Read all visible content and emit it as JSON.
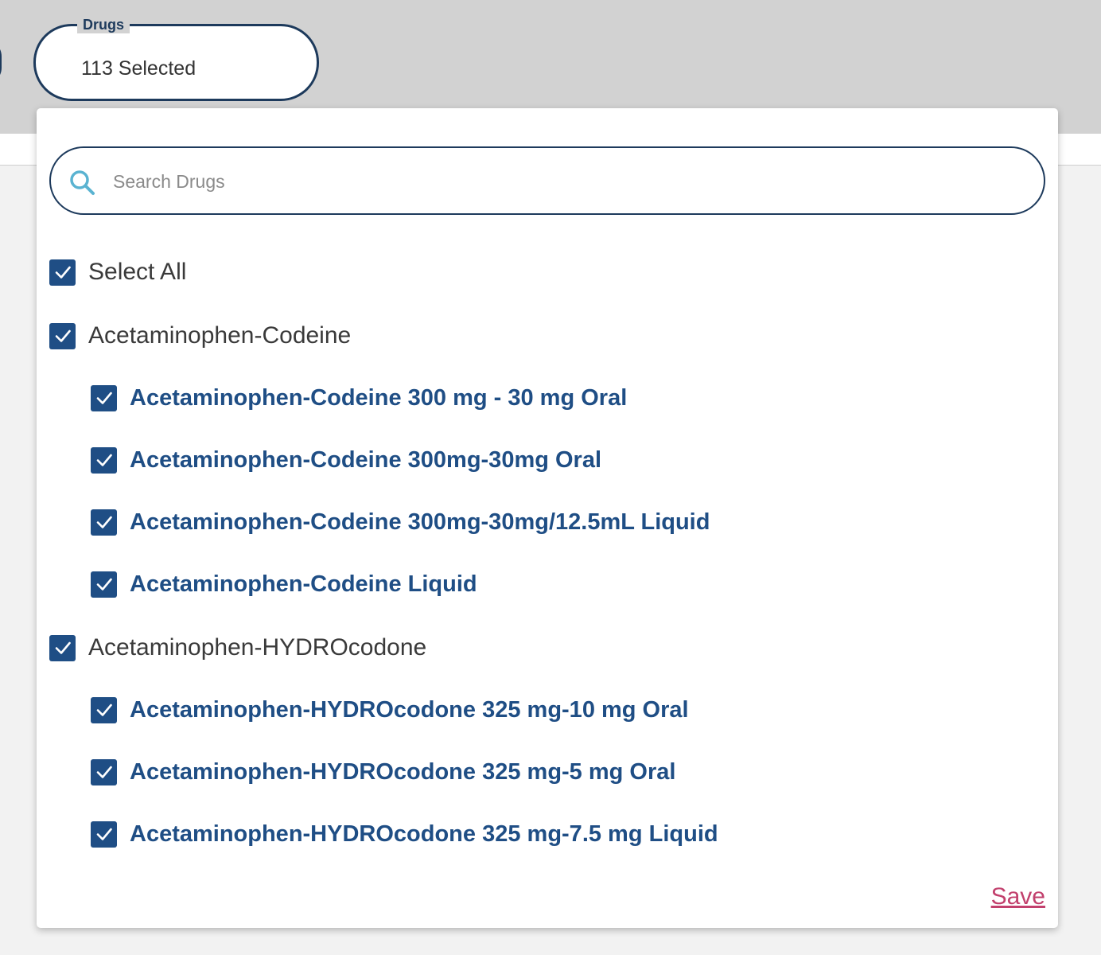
{
  "filter": {
    "label": "Drugs",
    "value": "113 Selected"
  },
  "search": {
    "placeholder": "Search Drugs",
    "value": ""
  },
  "select_all": {
    "label": "Select All",
    "checked": true
  },
  "groups": [
    {
      "label": "Acetaminophen-Codeine",
      "checked": true,
      "items": [
        {
          "label": "Acetaminophen-Codeine 300 mg - 30 mg Oral",
          "checked": true
        },
        {
          "label": "Acetaminophen-Codeine 300mg-30mg Oral",
          "checked": true
        },
        {
          "label": "Acetaminophen-Codeine 300mg-30mg/12.5mL Liquid",
          "checked": true
        },
        {
          "label": "Acetaminophen-Codeine Liquid",
          "checked": true
        }
      ]
    },
    {
      "label": "Acetaminophen-HYDROcodone",
      "checked": true,
      "items": [
        {
          "label": "Acetaminophen-HYDROcodone 325 mg-10 mg Oral",
          "checked": true
        },
        {
          "label": "Acetaminophen-HYDROcodone 325 mg-5 mg Oral",
          "checked": true
        },
        {
          "label": "Acetaminophen-HYDROcodone 325 mg-7.5 mg Liquid",
          "checked": true
        }
      ]
    }
  ],
  "actions": {
    "save_label": "Save"
  },
  "colors": {
    "primary": "#1d3a5c",
    "checkbox": "#1f4e85",
    "save_link": "#c2406d",
    "search_icon": "#5ab3d1"
  },
  "icons": {
    "search": "search-icon",
    "checkbox_checked": "checkmark-icon"
  }
}
